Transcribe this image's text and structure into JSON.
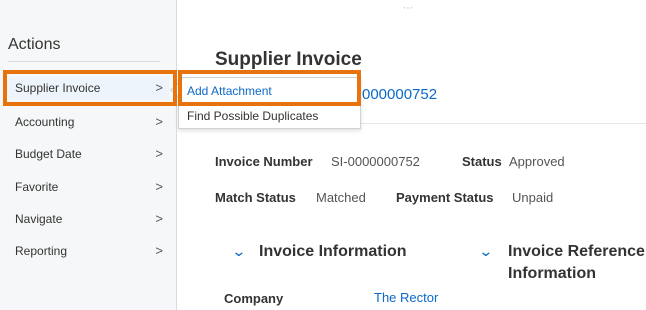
{
  "sidebar": {
    "title": "Actions",
    "items": [
      {
        "label": "Supplier Invoice",
        "chevron": ">"
      },
      {
        "label": "Accounting",
        "chevron": ">"
      },
      {
        "label": "Budget Date",
        "chevron": ">"
      },
      {
        "label": "Favorite",
        "chevron": ">"
      },
      {
        "label": "Navigate",
        "chevron": ">"
      },
      {
        "label": "Reporting",
        "chevron": ">"
      }
    ]
  },
  "submenu": {
    "items": [
      {
        "label": "Add Attachment"
      },
      {
        "label": "Find Possible Duplicates"
      }
    ]
  },
  "drag_handle": "⋯",
  "main": {
    "title": "Supplier Invoice",
    "invoice_id_partial": "000000752",
    "fields": {
      "invoice_number_label": "Invoice Number",
      "invoice_number_value": "SI-0000000752",
      "status_label": "Status",
      "status_value": "Approved",
      "match_status_label": "Match Status",
      "match_status_value": "Matched",
      "payment_status_label": "Payment Status",
      "payment_status_value": "Unpaid"
    },
    "sections": {
      "invoice_information": "Invoice Information",
      "invoice_reference_line1": "Invoice Reference",
      "invoice_reference_line2": "Information"
    },
    "company_label": "Company",
    "company_value": "The Rector"
  },
  "colors": {
    "accent": "#0b69c7",
    "highlight": "#e8730c"
  }
}
